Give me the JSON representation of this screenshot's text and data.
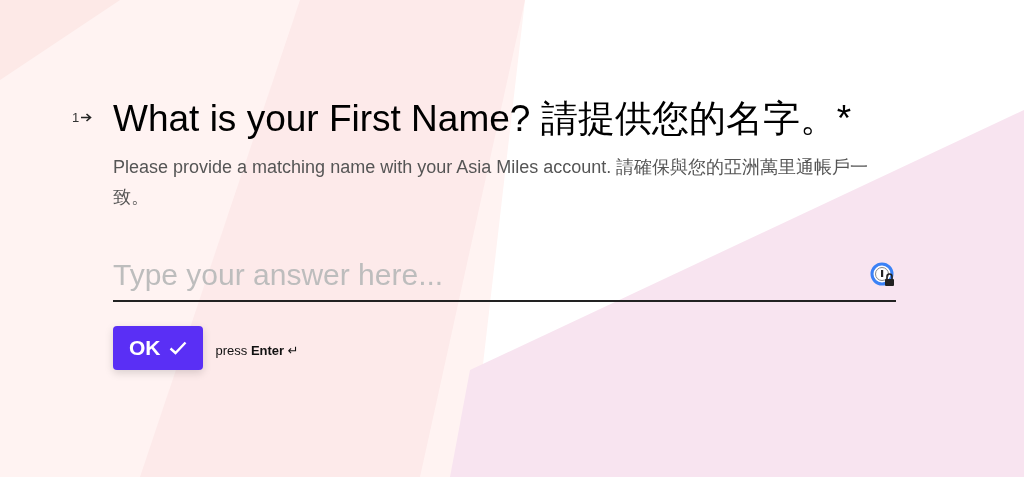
{
  "question": {
    "number": "1",
    "title": "What is your First Name? 請提供您的名字。",
    "required_mark": "*",
    "description": "Please provide a matching name with your Asia Miles account. 請確保與您的亞洲萬里通帳戶一致。"
  },
  "answer": {
    "placeholder": "Type your answer here..."
  },
  "ok_button": {
    "label": "OK"
  },
  "hint": "press **Enter** ↵"
}
